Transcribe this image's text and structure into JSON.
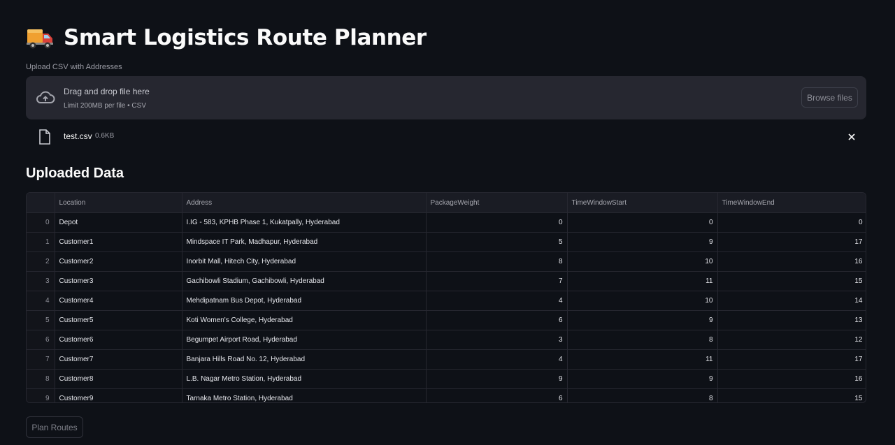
{
  "header": {
    "emoji_icon": "delivery-truck-icon",
    "title": "Smart Logistics Route Planner"
  },
  "uploader": {
    "label": "Upload CSV with Addresses",
    "primary_text": "Drag and drop file here",
    "secondary_text": "Limit 200MB per file • CSV",
    "browse_label": "Browse files",
    "file": {
      "name": "test.csv",
      "size": "0.6KB"
    }
  },
  "data_section": {
    "title": "Uploaded Data",
    "columns": [
      "",
      "Location",
      "Address",
      "PackageWeight",
      "TimeWindowStart",
      "TimeWindowEnd"
    ],
    "rows": [
      {
        "index": "0",
        "location": "Depot",
        "address": "I.IG - 583, KPHB Phase 1, Kukatpally, Hyderabad",
        "weight": "0",
        "start": "0",
        "end": "0"
      },
      {
        "index": "1",
        "location": "Customer1",
        "address": "Mindspace IT Park, Madhapur, Hyderabad",
        "weight": "5",
        "start": "9",
        "end": "17"
      },
      {
        "index": "2",
        "location": "Customer2",
        "address": "Inorbit Mall, Hitech City, Hyderabad",
        "weight": "8",
        "start": "10",
        "end": "16"
      },
      {
        "index": "3",
        "location": "Customer3",
        "address": "Gachibowli Stadium, Gachibowli, Hyderabad",
        "weight": "7",
        "start": "11",
        "end": "15"
      },
      {
        "index": "4",
        "location": "Customer4",
        "address": "Mehdipatnam Bus Depot, Hyderabad",
        "weight": "4",
        "start": "10",
        "end": "14"
      },
      {
        "index": "5",
        "location": "Customer5",
        "address": "Koti Women's College, Hyderabad",
        "weight": "6",
        "start": "9",
        "end": "13"
      },
      {
        "index": "6",
        "location": "Customer6",
        "address": "Begumpet Airport Road, Hyderabad",
        "weight": "3",
        "start": "8",
        "end": "12"
      },
      {
        "index": "7",
        "location": "Customer7",
        "address": "Banjara Hills Road No. 12, Hyderabad",
        "weight": "4",
        "start": "11",
        "end": "17"
      },
      {
        "index": "8",
        "location": "Customer8",
        "address": "L.B. Nagar Metro Station, Hyderabad",
        "weight": "9",
        "start": "9",
        "end": "16"
      },
      {
        "index": "9",
        "location": "Customer9",
        "address": "Tarnaka Metro Station, Hyderabad",
        "weight": "6",
        "start": "8",
        "end": "15"
      }
    ]
  },
  "actions": {
    "plan_label": "Plan Routes"
  }
}
